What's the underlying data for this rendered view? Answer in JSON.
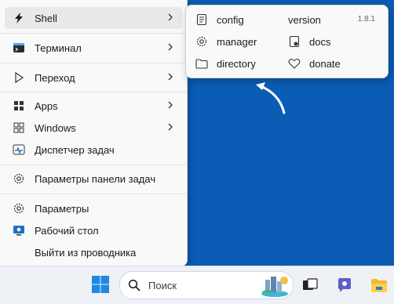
{
  "menu": {
    "items": [
      {
        "label": "Shell",
        "icon": "shell-icon"
      },
      {
        "label": "Терминал",
        "icon": "terminal-icon"
      },
      {
        "label": "Переход",
        "icon": "goto-icon"
      },
      {
        "label": "Apps",
        "icon": "apps-icon"
      },
      {
        "label": "Windows",
        "icon": "windows-icon"
      },
      {
        "label": "Диспетчер задач",
        "icon": "task-manager-icon"
      },
      {
        "label": "Параметры панели задач",
        "icon": "gear-icon"
      },
      {
        "label": "Параметры",
        "icon": "gear-icon"
      },
      {
        "label": "Рабочий стол",
        "icon": "desktop-icon"
      },
      {
        "label": "Выйти из проводника",
        "icon": ""
      }
    ]
  },
  "submenu": {
    "items": [
      {
        "label": "config",
        "icon": "config-icon"
      },
      {
        "label": "version",
        "icon": ""
      },
      {
        "label": "manager",
        "icon": "gear-icon"
      },
      {
        "label": "docs",
        "icon": "docs-icon"
      },
      {
        "label": "directory",
        "icon": "folder-icon"
      },
      {
        "label": "donate",
        "icon": "heart-icon"
      }
    ],
    "version_value": "1.8.1"
  },
  "taskbar": {
    "search_label": "Поиск",
    "icons": [
      "windows-start-icon",
      "search-icon",
      "search-highlight-icon",
      "task-view-icon",
      "chat-icon",
      "file-explorer-icon"
    ]
  },
  "colors": {
    "desktop": "#0b5cb5",
    "menu_bg": "#f9f9f9",
    "accent": "#0067c0"
  }
}
